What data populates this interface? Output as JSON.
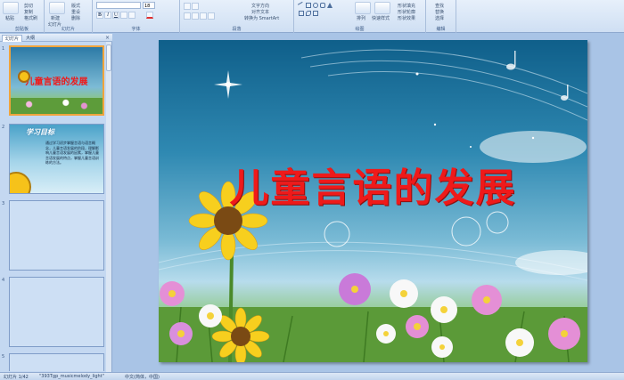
{
  "ribbon": {
    "clipboard": {
      "paste": "粘贴",
      "cut": "剪切",
      "copy": "复制",
      "format_painter": "格式刷",
      "group_label": "剪贴板"
    },
    "slides": {
      "new_slide": "新建",
      "new_slide_line2": "幻灯片",
      "layout": "版式",
      "reset": "重设",
      "delete": "删除",
      "group_label": "幻灯片"
    },
    "font": {
      "size": "18",
      "bold": "B",
      "italic": "I",
      "underline": "U",
      "group_label": "字体"
    },
    "paragraph": {
      "text_direction": "文字方向",
      "align_text": "对齐文本",
      "smartart": "转换为 SmartArt",
      "group_label": "段落"
    },
    "drawing": {
      "arrange": "排列",
      "quick_styles": "快速样式",
      "shape_fill": "形状填充",
      "shape_outline": "形状轮廓",
      "shape_effects": "形状效果",
      "group_label": "绘图"
    },
    "editing": {
      "find": "查找",
      "replace": "替换",
      "select": "选择",
      "group_label": "编辑"
    }
  },
  "left_pane": {
    "tabs": [
      "幻灯片",
      "大纲"
    ],
    "close": "×",
    "thumbnails": [
      {
        "num": "1",
        "title": "儿童言语的发展"
      },
      {
        "num": "2",
        "title": "学习目标",
        "body": "通过学习初步掌握言语与语言概念，儿童言语发展的阶段，理解影响儿童言语发展的因素，掌握儿童言语发展的特点，掌握儿童言语训练的方法。"
      },
      {
        "num": "3"
      },
      {
        "num": "4"
      },
      {
        "num": "5"
      }
    ]
  },
  "slide": {
    "title": "儿童言语的发展"
  },
  "status_bar": {
    "slide_count": "幻灯片 1/42",
    "theme": "\"393Tgp_musicmelody_light\"",
    "language": "中文(简体，中国)"
  },
  "colors": {
    "title_red": "#ef1a1a",
    "ribbon_bg": "#dbe7f6",
    "selected_border": "#f0a43c"
  }
}
